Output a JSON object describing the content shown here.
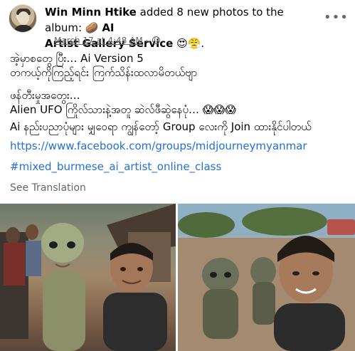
{
  "post": {
    "author": "Win Minn Htike",
    "action_text": "added 8 new photos to the album:",
    "album_emoji": "🥔",
    "album_name_line1": "AI",
    "album_name_line2": "Artist Gallery Service",
    "album_trailing_emoji": "😍😤.",
    "timestamp": "March 17 at 4:48 AM",
    "separator": "·",
    "privacy_icon": "globe-icon",
    "more_label": "•••"
  },
  "body": {
    "lines": [
      "အဲ့မှာစတွေ ပြီး… Ai Version 5",
      "တကယ့်ကိုကြည့်ရင်း ကြက်သိန်းထလာမိတယ်ဗျာ",
      "ဖန်တီးမှုအတွေး…",
      "Alien UFO ကြိုလ်သားနဲ့အတူ ဆဲလ်ဖီဆွဲနေပုံ… 😱😱😱",
      "Ai နည်းပညာပုံများ မျှဝေရာ ကျွန်တော့် Group လေးကို Join ထားနိုင်ပါတယ်"
    ],
    "link": "https://www.facebook.com/groups/midjourneymyanmar",
    "hashtag": "#mixed_burmese_ai_artist_online_class",
    "see_translation": "See Translation"
  },
  "photos": [
    {
      "subject": "alien-selfie-village-photo"
    },
    {
      "subject": "alien-selfie-road-photo"
    }
  ]
}
